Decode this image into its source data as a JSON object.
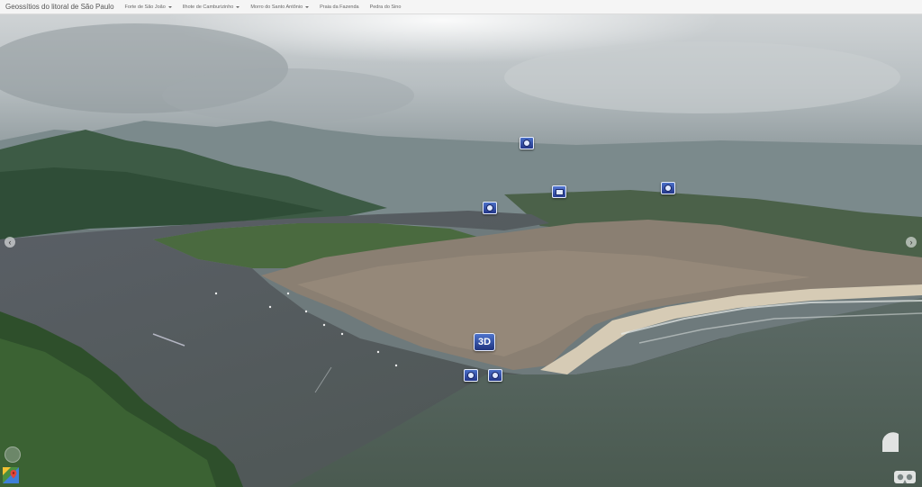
{
  "navbar": {
    "brand": "Geossítios do litoral de São Paulo",
    "items": [
      {
        "label": "Forte de São João",
        "dropdown": true
      },
      {
        "label": "Ilhote de Camburizinho",
        "dropdown": true
      },
      {
        "label": "Morro do Santo Antônio",
        "dropdown": true
      },
      {
        "label": "Praia da Fazenda",
        "dropdown": false
      },
      {
        "label": "Pedra do Sino",
        "dropdown": false
      }
    ]
  },
  "pano": {
    "hotspot_3d_label": "3D",
    "left_arrow": "‹",
    "right_arrow": "›",
    "icons": {
      "photo": "camera-icon",
      "video": "video-icon",
      "maps": "google-maps-icon",
      "compass": "compass-icon",
      "vr": "vr-headset-icon"
    }
  }
}
